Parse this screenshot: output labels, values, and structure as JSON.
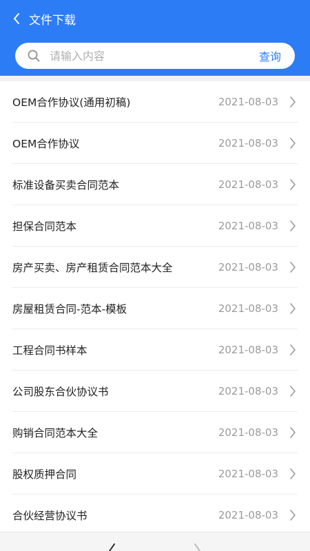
{
  "header": {
    "title": "文件下载",
    "back_icon": "chevron-left-icon"
  },
  "search": {
    "placeholder": "请输入内容",
    "button_label": "查询"
  },
  "colors": {
    "primary": "#2c7cf6",
    "date": "#9a9a9a"
  },
  "documents": [
    {
      "title": "OEM合作协议(通用初稿)",
      "date": "2021-08-03"
    },
    {
      "title": "OEM合作协议",
      "date": "2021-08-03"
    },
    {
      "title": "标准设备买卖合同范本",
      "date": "2021-08-03"
    },
    {
      "title": "担保合同范本",
      "date": "2021-08-03"
    },
    {
      "title": "房产买卖、房产租赁合同范本大全",
      "date": "2021-08-03"
    },
    {
      "title": "房屋租赁合同-范本-模板",
      "date": "2021-08-03"
    },
    {
      "title": "工程合同书样本",
      "date": "2021-08-03"
    },
    {
      "title": "公司股东合伙协议书",
      "date": "2021-08-03"
    },
    {
      "title": "购销合同范本大全",
      "date": "2021-08-03"
    },
    {
      "title": "股权质押合同",
      "date": "2021-08-03"
    },
    {
      "title": "合伙经营协议书",
      "date": "2021-08-03"
    }
  ]
}
